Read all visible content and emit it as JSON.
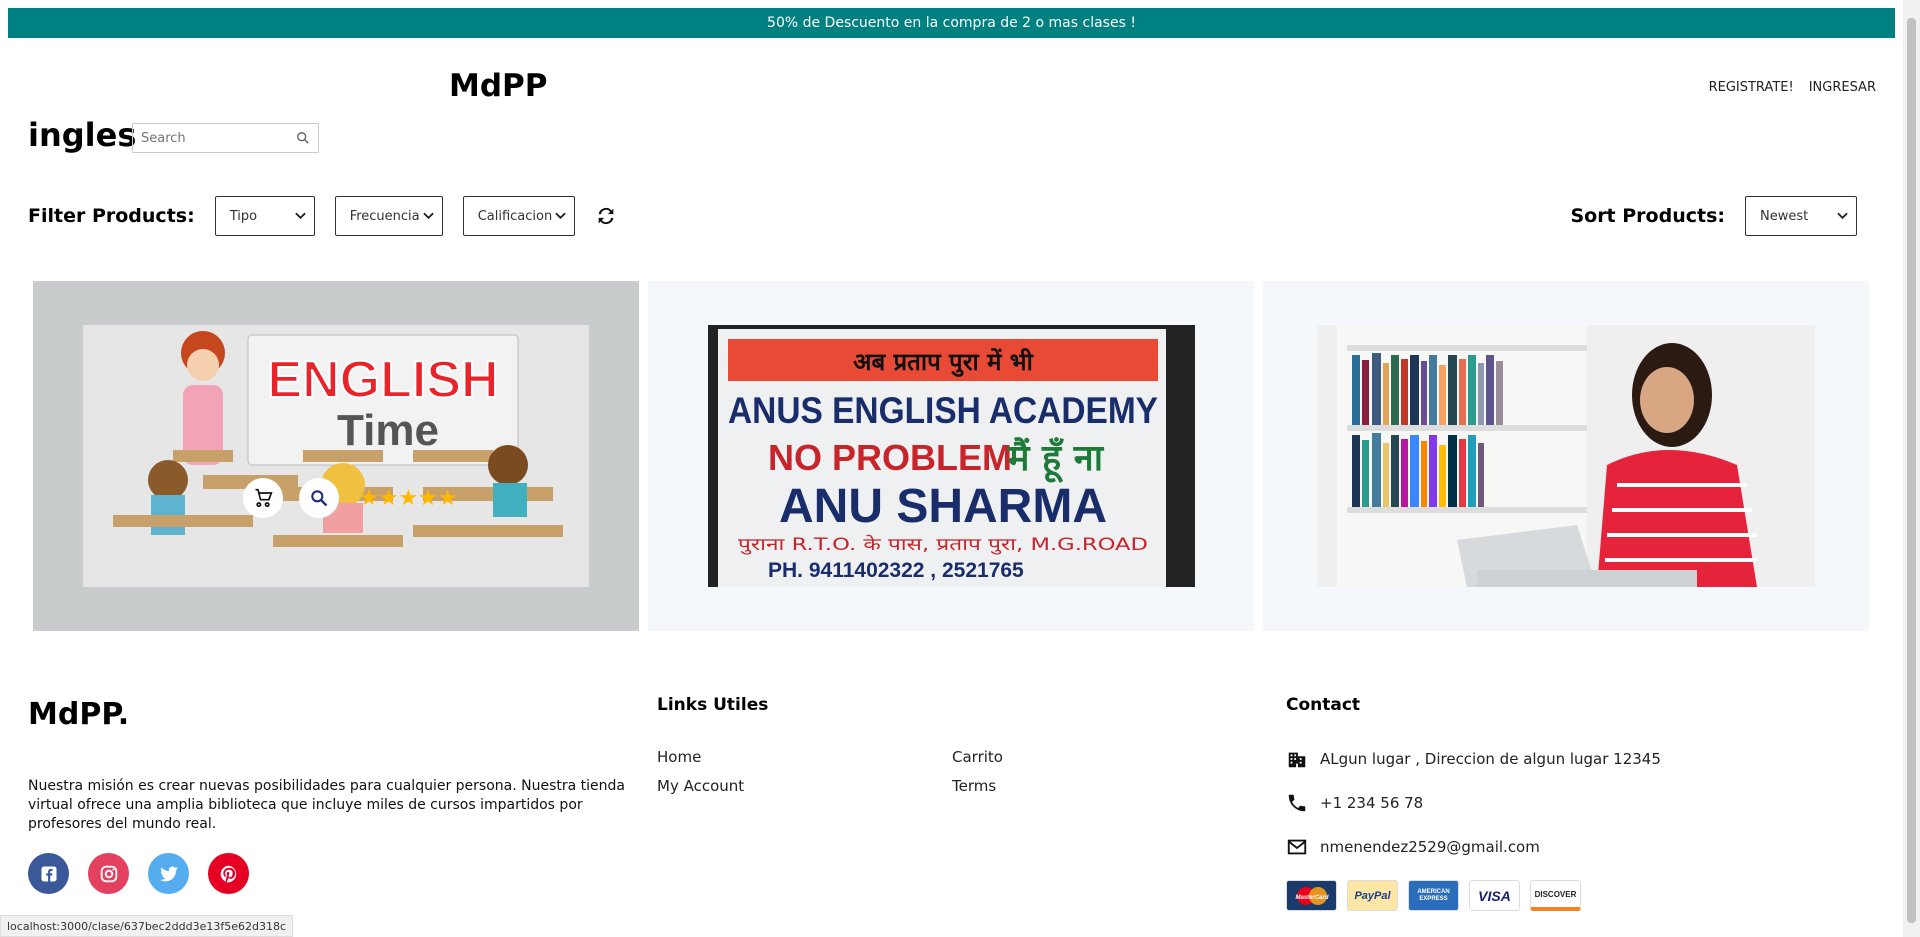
{
  "announcement": "50% de Descuento en la compra de 2 o mas clases !",
  "header": {
    "brand": "MdPP",
    "register_label": "REGISTRATE!",
    "login_label": "INGRESAR"
  },
  "category_title": "ingles",
  "search": {
    "placeholder": "Search"
  },
  "filters": {
    "label": "Filter Products:",
    "tipo": "Tipo",
    "frecuencia": "Frecuencia",
    "calificacion": "Calificacion"
  },
  "sort": {
    "label": "Sort Products:",
    "value": "Newest"
  },
  "cards": [
    {
      "title_line1": "ENGLISH",
      "title_line2": "Time",
      "rating": 5,
      "rating_stars": "★★★★★"
    },
    {
      "sign_hindi_top": "अब प्रताप पुरा में भी",
      "sign_line1": "ANUS ENGLISH ACADEMY",
      "sign_line2a": "NO PROBLEM",
      "sign_line2b": "मैं हूँ ना",
      "sign_line3": "ANU SHARMA",
      "sign_line4": "पुराना R.T.O. के पास, प्रताप पुरा, M.G.ROAD",
      "sign_line5": "PH. 9411402322 ,     2521765"
    },
    {}
  ],
  "footer": {
    "brand": "MdPP.",
    "mission": "Nuestra misión es crear nuevas posibilidades para cualquier persona. Nuestra tienda virtual ofrece una amplia biblioteca que incluye miles de cursos impartidos por profesores del mundo real.",
    "links_title": "Links Utiles",
    "links": {
      "home": "Home",
      "carrito": "Carrito",
      "account": "My Account",
      "terms": "Terms"
    },
    "contact_title": "Contact",
    "address": "ALgun lugar , Direccion de algun lugar 12345",
    "phone": "+1 234 56 78",
    "email": "nmenendez2529@gmail.com",
    "payments": [
      "MasterCard",
      "PayPal",
      "AMERICAN EXPRESS",
      "VISA",
      "DISCOVER"
    ],
    "social_colors": {
      "facebook": "#3b5998",
      "instagram": "#e4405f",
      "twitter": "#55acee",
      "pinterest": "#e60023"
    }
  },
  "status_url": "localhost:3000/clase/637bec2ddd3e13f5e62d318c",
  "colors": {
    "accent": "#008080",
    "star": "#ffb800"
  }
}
